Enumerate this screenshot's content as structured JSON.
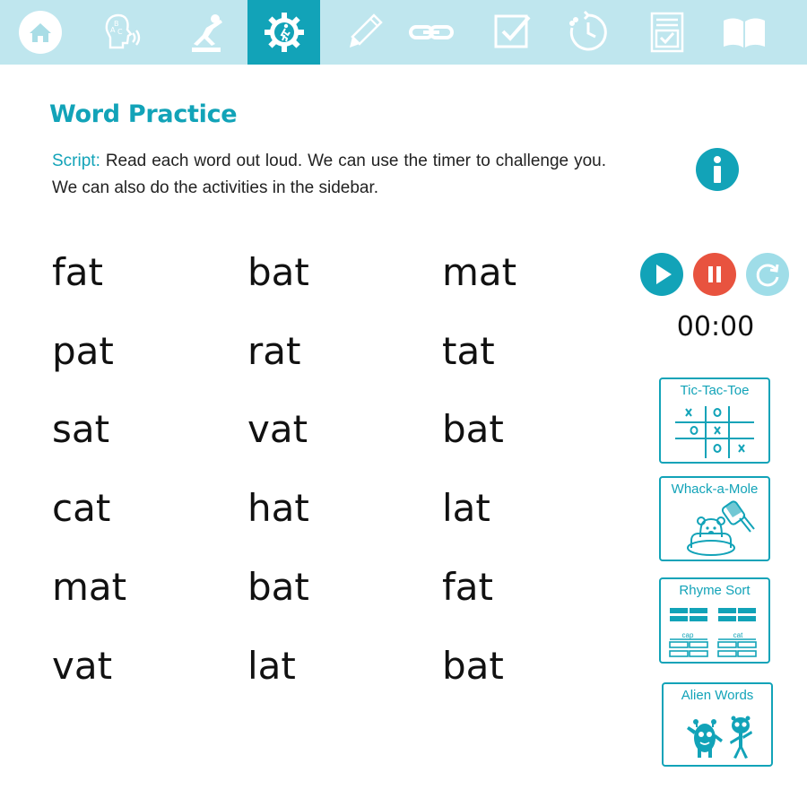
{
  "nav": {
    "items": [
      {
        "icon": "home-icon",
        "active": false
      },
      {
        "icon": "phonics-speech-icon",
        "active": false
      },
      {
        "icon": "exercise-icon",
        "active": false
      },
      {
        "icon": "practice-gear-icon",
        "active": true
      },
      {
        "icon": "pencil-icon",
        "active": false
      },
      {
        "icon": "chain-link-icon",
        "active": false
      },
      {
        "icon": "checkbox-icon",
        "active": false
      },
      {
        "icon": "progress-timer-icon",
        "active": false
      },
      {
        "icon": "checklist-document-icon",
        "active": false
      },
      {
        "icon": "open-book-icon",
        "active": false
      }
    ]
  },
  "page": {
    "title": "Word Practice",
    "script_label": "Script:",
    "script_text": " Read each word out loud. We can use the timer to challenge you. We can also do the activities in the sidebar."
  },
  "words": [
    [
      "fat",
      "bat",
      "mat"
    ],
    [
      "pat",
      "rat",
      "tat"
    ],
    [
      "sat",
      "vat",
      "bat"
    ],
    [
      "cat",
      "hat",
      "lat"
    ],
    [
      "mat",
      "bat",
      "fat"
    ],
    [
      "vat",
      "lat",
      "bat"
    ]
  ],
  "timer": {
    "display": "00:00"
  },
  "activities": [
    {
      "label": "Tic-Tac-Toe",
      "icon": "tic-tac-toe-icon",
      "cells": [
        "x",
        "o",
        "",
        "o",
        "x",
        "",
        "",
        "o",
        "x"
      ]
    },
    {
      "label": "Whack-a-Mole",
      "icon": "whack-a-mole-icon"
    },
    {
      "label": "Rhyme Sort",
      "icon": "rhyme-sort-icon",
      "left_tag": "cap",
      "right_tag": "cat"
    },
    {
      "label": "Alien Words",
      "icon": "alien-icon"
    }
  ],
  "colors": {
    "accent": "#12a3b8",
    "nav_bg": "#bfe6ee",
    "pause": "#e8533f",
    "reset": "#9fdde8"
  }
}
